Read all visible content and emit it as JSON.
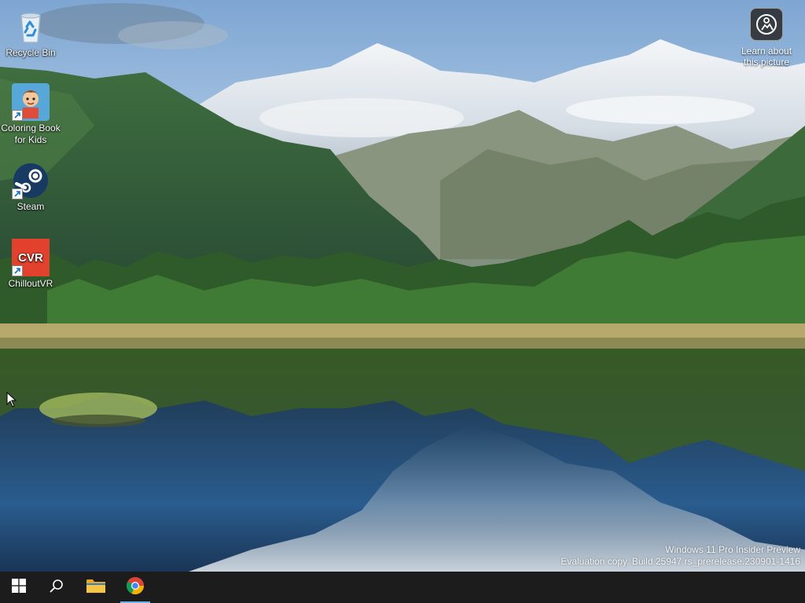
{
  "desktop": {
    "icons": [
      {
        "label": "Recycle Bin",
        "icon": "recycle-bin-icon"
      },
      {
        "label": "Coloring Book for Kids",
        "icon": "coloring-book-icon"
      },
      {
        "label": "Steam",
        "icon": "steam-icon"
      },
      {
        "label": "ChilloutVR",
        "icon": "chilloutvr-icon"
      }
    ],
    "learn_about": {
      "label": "Learn about this picture",
      "icon": "camera-info-icon"
    },
    "chilloutvr_logo_text": "CVR"
  },
  "watermark": {
    "line1": "Windows 11 Pro Insider Preview",
    "line2": "Evaluation copy. Build 25947.rs_prerelease.230901-1416"
  },
  "taskbar": {
    "items": [
      {
        "name": "Start",
        "icon": "windows-start-icon"
      },
      {
        "name": "Search",
        "icon": "search-icon"
      },
      {
        "name": "File Explorer",
        "icon": "file-explorer-icon"
      },
      {
        "name": "Google Chrome",
        "icon": "chrome-icon",
        "active": true
      }
    ]
  },
  "colors": {
    "taskbar_bg": "#1c1c1c",
    "active_indicator": "#6fb3e6",
    "sky": "#8fb6dc",
    "lake": "#1f3f6a"
  }
}
